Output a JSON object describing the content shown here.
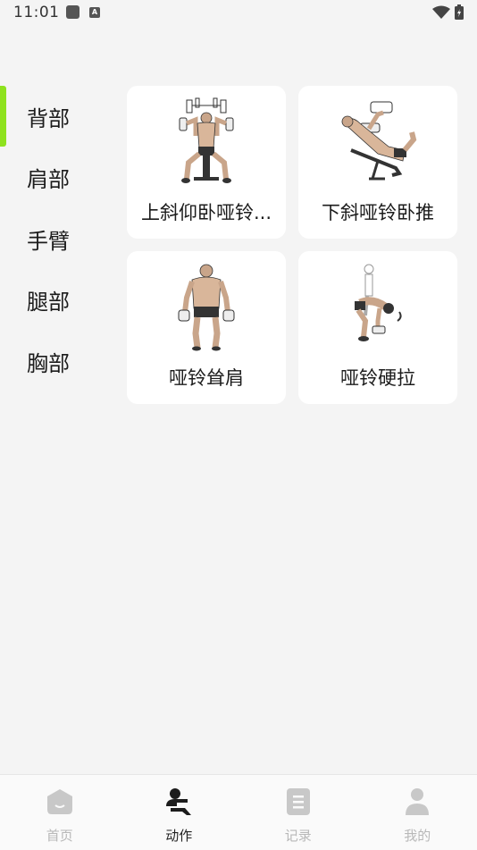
{
  "status_bar": {
    "time": "11:01",
    "notif_letter": "A"
  },
  "sidebar": {
    "active_index": 0,
    "items": [
      {
        "label": "背部"
      },
      {
        "label": "肩部"
      },
      {
        "label": "手臂"
      },
      {
        "label": "腿部"
      },
      {
        "label": "胸部"
      }
    ]
  },
  "exercises": [
    {
      "name": "上斜仰卧哑铃...",
      "icon": "incline-dumbbell-press-illustration"
    },
    {
      "name": "下斜哑铃卧推",
      "icon": "decline-dumbbell-press-illustration"
    },
    {
      "name": "哑铃耸肩",
      "icon": "dumbbell-shrug-illustration"
    },
    {
      "name": "哑铃硬拉",
      "icon": "dumbbell-deadlift-illustration"
    }
  ],
  "bottom_nav": {
    "active_index": 1,
    "items": [
      {
        "label": "首页",
        "icon": "home-icon"
      },
      {
        "label": "动作",
        "icon": "exercise-icon"
      },
      {
        "label": "记录",
        "icon": "record-icon"
      },
      {
        "label": "我的",
        "icon": "profile-icon"
      }
    ]
  },
  "colors": {
    "accent": "#8ee21e",
    "background": "#f4f4f4",
    "card": "#ffffff",
    "nav_inactive": "#b8b8b8"
  }
}
